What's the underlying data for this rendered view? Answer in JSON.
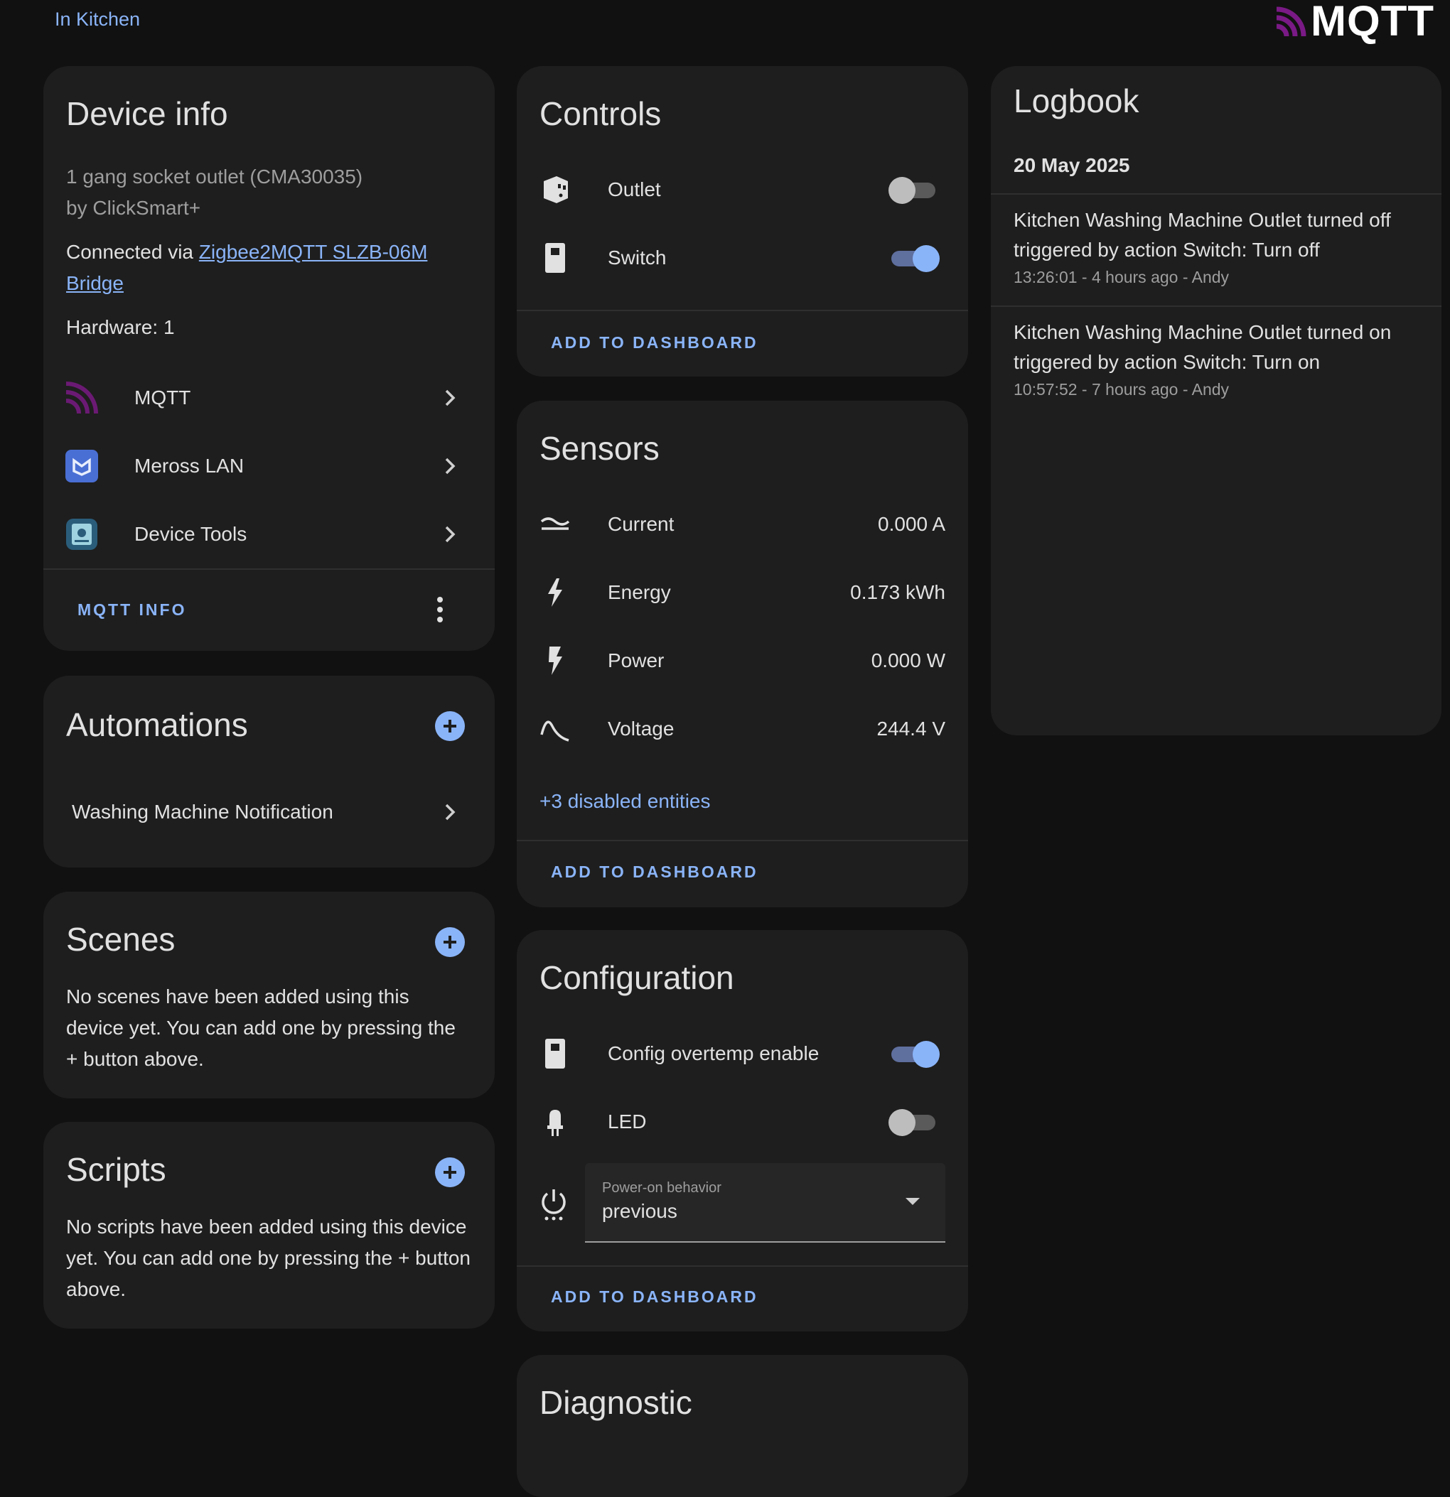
{
  "header": {
    "area_link": "In Kitchen",
    "brand": "MQTT"
  },
  "device_info": {
    "title": "Device info",
    "model": "1 gang socket outlet (CMA30035)",
    "manufacturer": "by ClickSmart+",
    "connected_prefix": "Connected via ",
    "connected_link_1": "Zigbee2MQTT SLZB-06M",
    "connected_link_2": "Bridge",
    "hardware": "Hardware: 1",
    "integrations": [
      {
        "label": "MQTT",
        "icon": "mqtt-icon"
      },
      {
        "label": "Meross LAN",
        "icon": "meross-icon"
      },
      {
        "label": "Device Tools",
        "icon": "device-tools-icon"
      }
    ],
    "action_label": "MQTT INFO"
  },
  "automations": {
    "title": "Automations",
    "items": [
      "Washing Machine Notification"
    ]
  },
  "scenes": {
    "title": "Scenes",
    "empty_text": "No scenes have been added using this device yet. You can add one by pressing the + button above."
  },
  "scripts": {
    "title": "Scripts",
    "empty_text": "No scripts have been added using this device yet. You can add one by pressing the + button above."
  },
  "controls": {
    "title": "Controls",
    "items": [
      {
        "label": "Outlet",
        "state": "off",
        "icon": "power-socket-icon"
      },
      {
        "label": "Switch",
        "state": "on",
        "icon": "switch-icon"
      }
    ],
    "add_label": "ADD TO DASHBOARD"
  },
  "sensors": {
    "title": "Sensors",
    "items": [
      {
        "label": "Current",
        "value": "0.000 A",
        "icon": "current-ac-icon"
      },
      {
        "label": "Energy",
        "value": "0.173 kWh",
        "icon": "lightning-bolt-icon"
      },
      {
        "label": "Power",
        "value": "0.000 W",
        "icon": "flash-icon"
      },
      {
        "label": "Voltage",
        "value": "244.4 V",
        "icon": "sine-wave-icon"
      }
    ],
    "disabled_link": "+3 disabled entities",
    "add_label": "ADD TO DASHBOARD"
  },
  "configuration": {
    "title": "Configuration",
    "items": [
      {
        "label": "Config overtemp enable",
        "state": "on",
        "icon": "switch-icon"
      },
      {
        "label": "LED",
        "state": "off",
        "icon": "led-icon"
      }
    ],
    "select": {
      "label": "Power-on behavior",
      "value": "previous",
      "icon": "power-settings-icon"
    },
    "add_label": "ADD TO DASHBOARD"
  },
  "diagnostic": {
    "title": "Diagnostic"
  },
  "logbook": {
    "title": "Logbook",
    "date": "20 May 2025",
    "entries": [
      {
        "line1": "Kitchen Washing Machine Outlet turned off",
        "line2": "triggered by action Switch: Turn off",
        "meta": "13:26:01 - 4 hours ago - Andy"
      },
      {
        "line1": "Kitchen Washing Machine Outlet turned on",
        "line2": "triggered by action Switch: Turn on",
        "meta": "10:57:52 - 7 hours ago - Andy"
      }
    ]
  },
  "colors": {
    "accent": "#8ab4f8",
    "card": "#1e1e1e",
    "background": "#111111",
    "mqtt_brand": "#660066"
  }
}
